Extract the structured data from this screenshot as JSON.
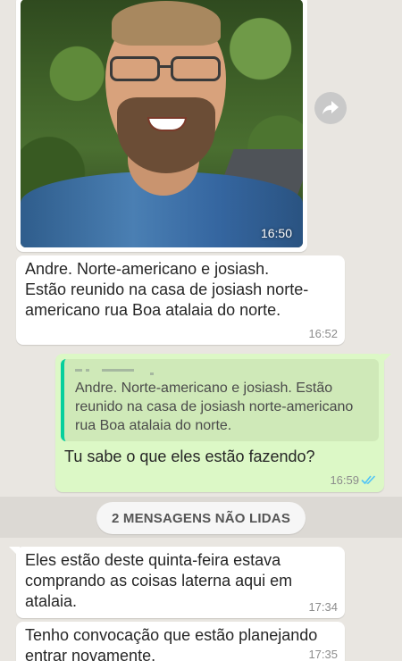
{
  "messages": {
    "photo": {
      "time": "16:50"
    },
    "incoming_1": {
      "text": "Andre. Norte-americano e josiash.\nEstão reunido na casa de josiash norte-americano rua Boa atalaia do norte.",
      "time": "16:52"
    },
    "outgoing_reply": {
      "quoted_text": "Andre. Norte-americano e josiash. Estão reunido na casa de josiash norte-americano rua Boa atalaia do norte.",
      "text": "Tu sabe o que eles estão fazendo?",
      "time": "16:59",
      "status_icon": "double-check-icon"
    },
    "unread_banner": "2 MENSAGENS NÃO LIDAS",
    "incoming_2": {
      "text": "Eles estão deste quinta-feira estava comprando as coisas laterna aqui em atalaia.",
      "time": "17:34"
    },
    "incoming_3": {
      "text": "Tenho convocação que estão planejando entrar novamente.",
      "time": "17:35"
    }
  },
  "colors": {
    "background": "#e9e6e1",
    "incoming_bubble": "#ffffff",
    "outgoing_bubble": "#dcf8c6",
    "read_tick": "#4fc3f7",
    "quote_bar": "#06cf9c"
  },
  "icons": {
    "forward": "forward-icon"
  }
}
